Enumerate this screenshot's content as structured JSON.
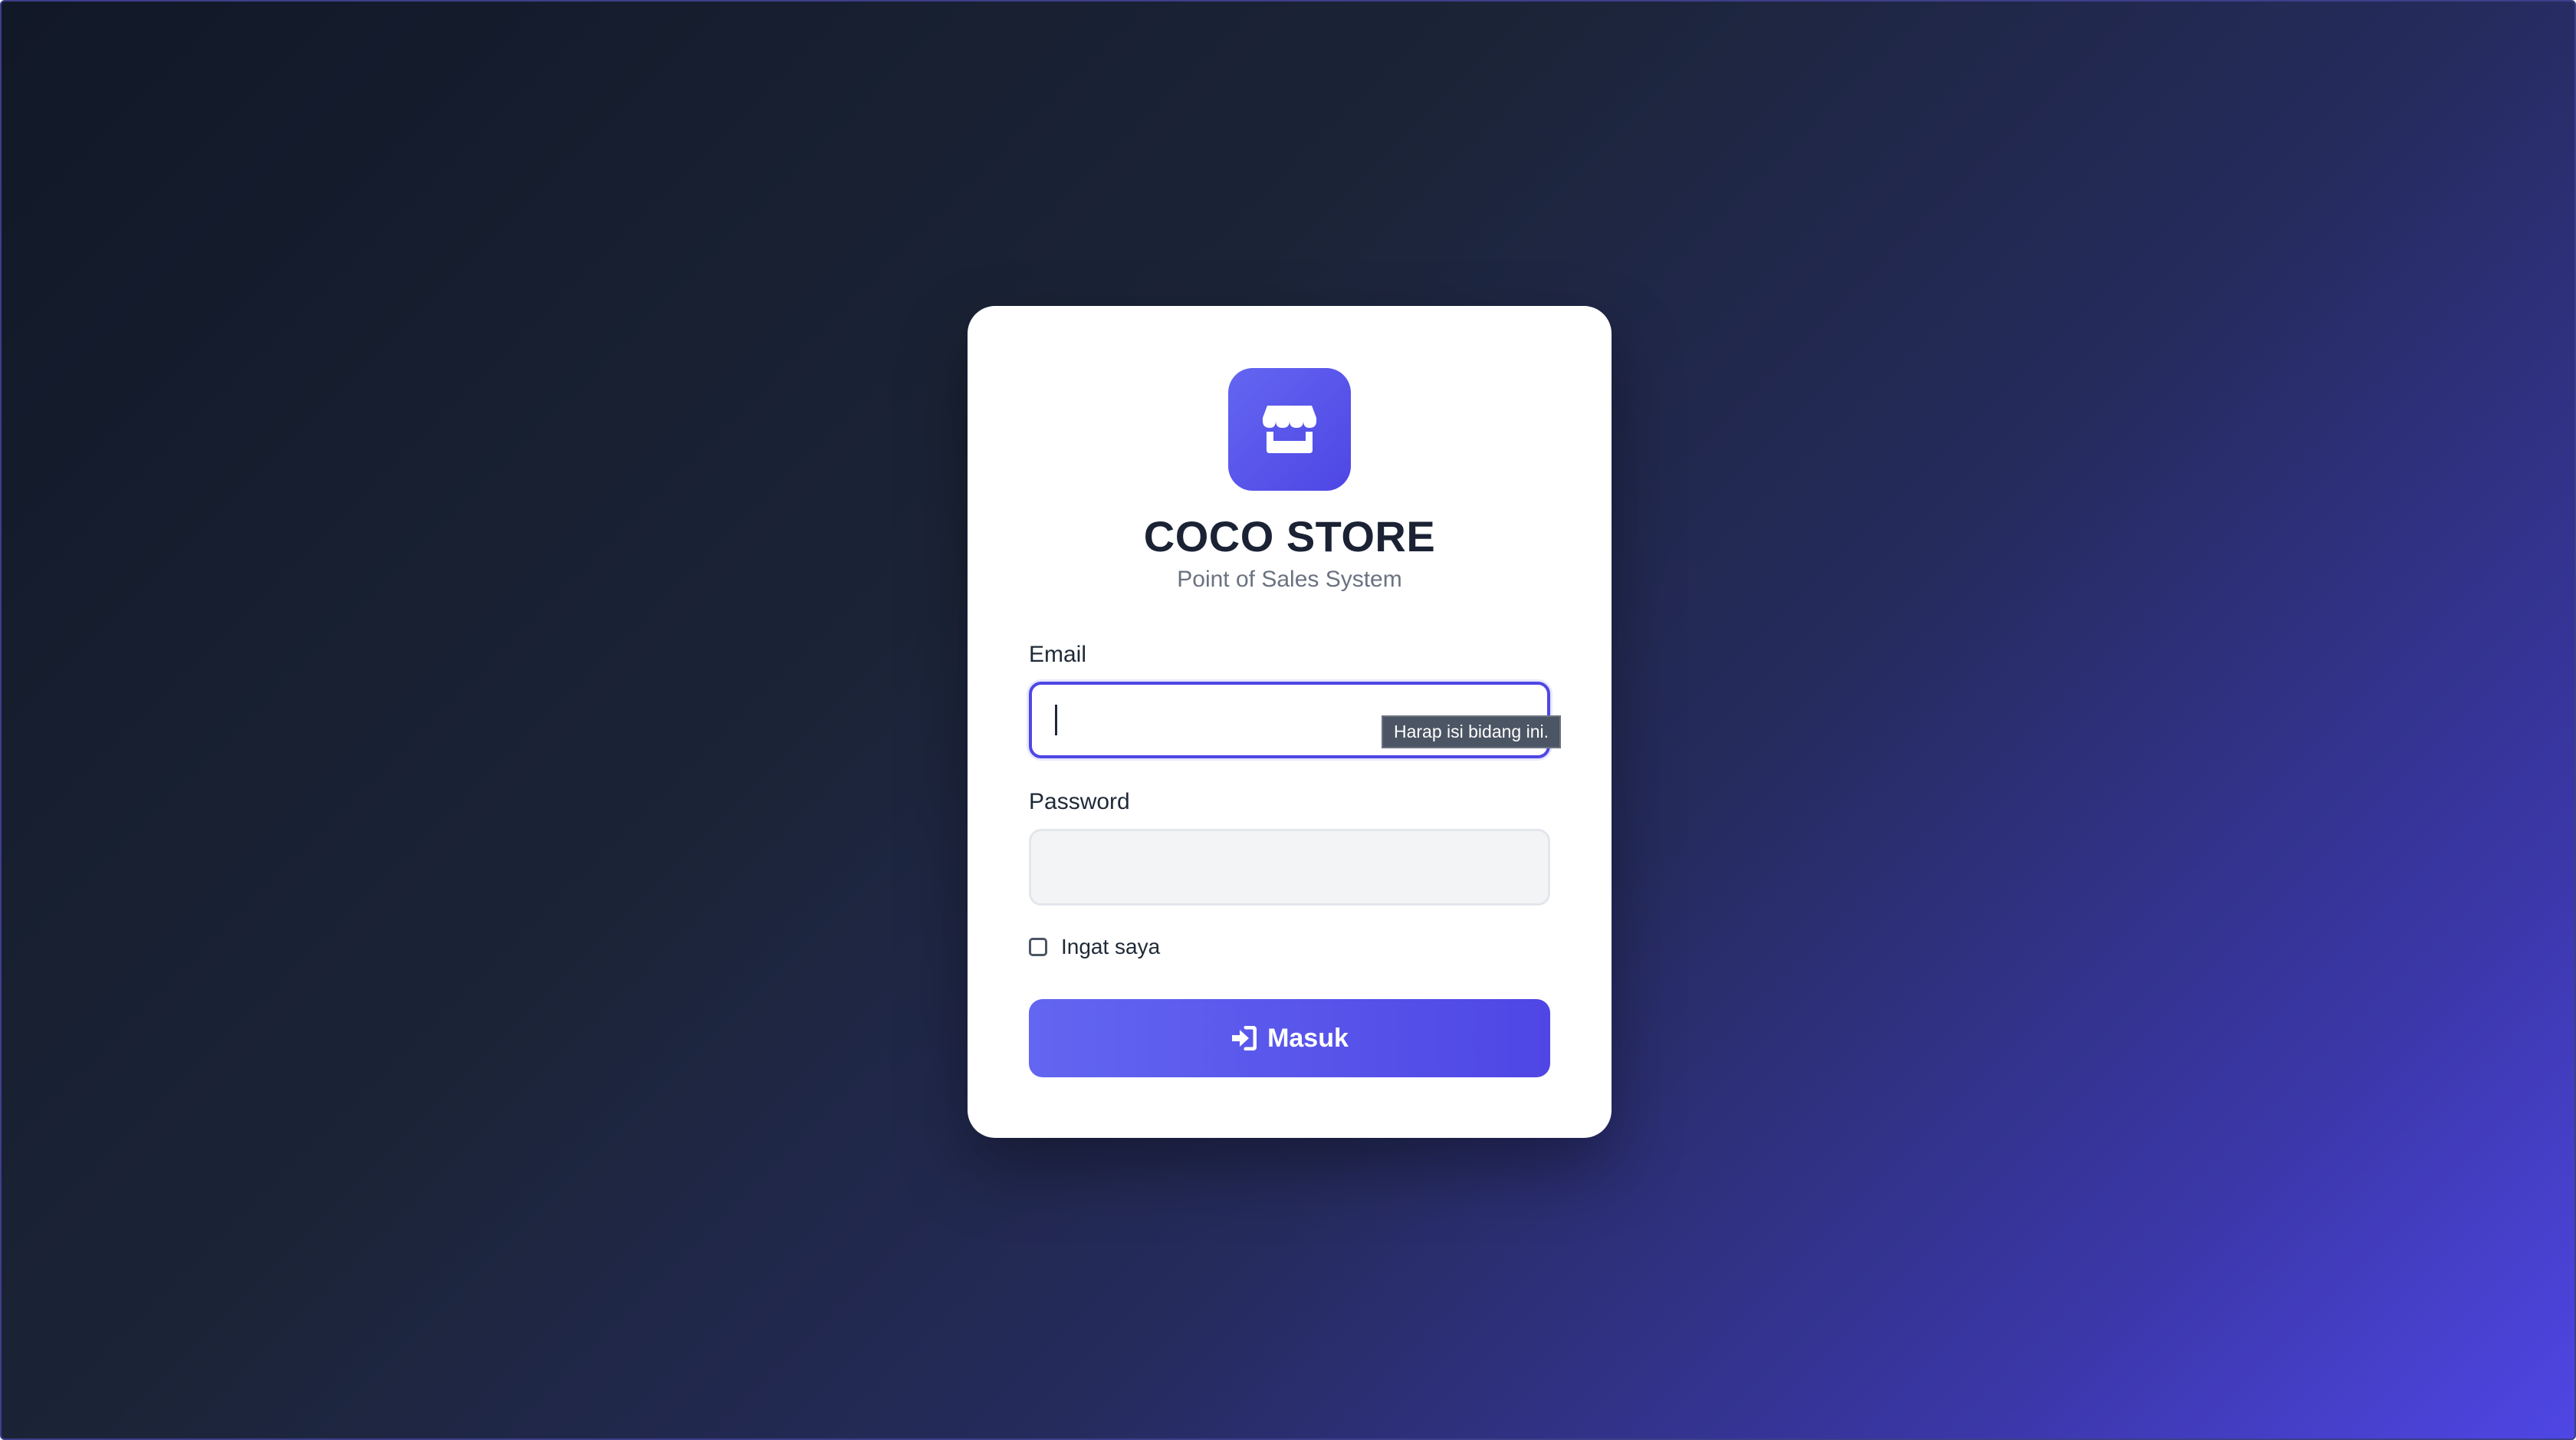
{
  "app": {
    "title": "COCO STORE",
    "subtitle": "Point of Sales System"
  },
  "icons": {
    "logo": "store-icon",
    "button": "sign-in-icon"
  },
  "form": {
    "email_label": "Email",
    "email_value": "",
    "email_placeholder": "",
    "password_label": "Password",
    "password_value": "",
    "password_placeholder": "",
    "remember_label": "Ingat saya",
    "remember_checked": false,
    "submit_label": "Masuk"
  },
  "validation": {
    "tooltip": "Harap isi bidang ini."
  },
  "colors": {
    "accent": "#4f46e5",
    "accent_light": "#6366f1",
    "title": "#1a2234",
    "subtitle": "#6b7280",
    "background_dark": "#111827",
    "card": "#ffffff"
  }
}
